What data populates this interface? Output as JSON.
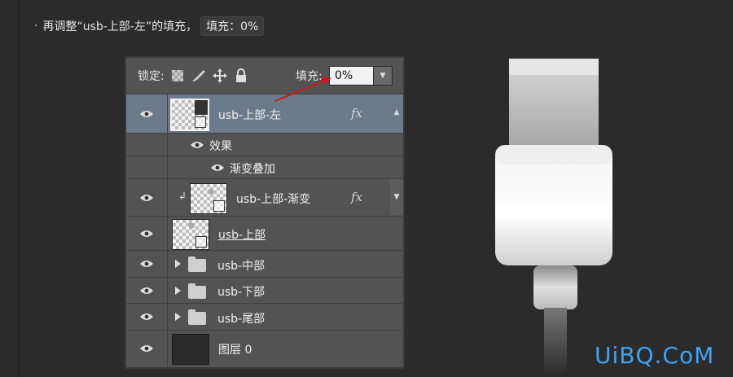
{
  "instruction": {
    "text": "再调整“usb-上部-左”的填充，",
    "tag": "填充：0%"
  },
  "lockbar": {
    "lock_label": "锁定:",
    "fill_label": "填充:",
    "fill_value": "0%"
  },
  "layers": [
    {
      "name": "usb-上部-左",
      "selected": true,
      "fx": "fx"
    },
    {
      "name": "效果",
      "sub": true
    },
    {
      "name": "渐变叠加",
      "sub": true
    },
    {
      "name": "usb-上部-渐变",
      "fx": "fx"
    },
    {
      "name": "usb-上部"
    },
    {
      "name": "usb-中部",
      "group": true
    },
    {
      "name": "usb-下部",
      "group": true
    },
    {
      "name": "usb-尾部",
      "group": true
    },
    {
      "name": "图层 0"
    }
  ],
  "watermark": "UiBQ.CoM",
  "colors": {
    "background": "#2b2b2b",
    "panel": "#535353",
    "selected": "#6c7a8c",
    "arrow": "#d0151c",
    "watermark": "#3fa3f5"
  }
}
